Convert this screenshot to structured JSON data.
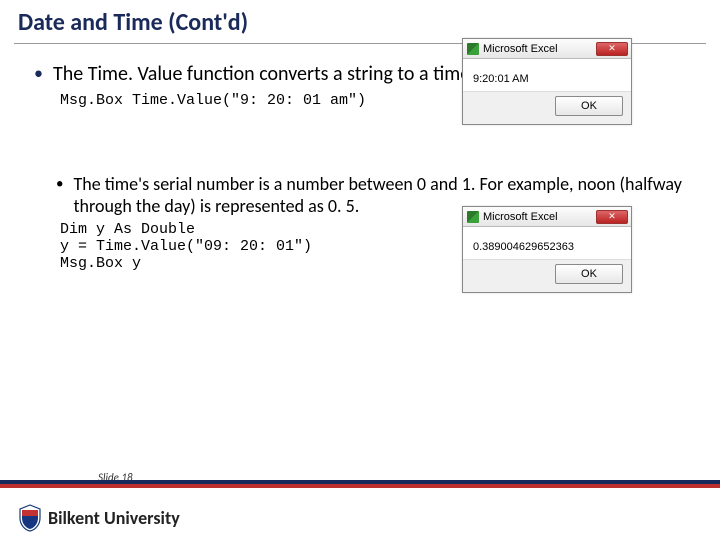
{
  "title": "Date and Time (Cont'd)",
  "bullet1": "The Time. Value function converts a string to a time serial number.",
  "code1": "Msg.Box Time.Value(\"9: 20: 01 am\")",
  "dialog1": {
    "title": "Microsoft Excel",
    "body": "9:20:01 AM",
    "ok": "OK"
  },
  "bullet2": "The time's serial number is a number between 0 and 1. For example, noon (halfway through the day) is represented as 0. 5.",
  "code2_l1": "Dim y As Double",
  "code2_l2": "y = Time.Value(\"09: 20: 01\")",
  "code2_l3": "Msg.Box y",
  "dialog2": {
    "title": "Microsoft Excel",
    "body": "0.389004629652363",
    "ok": "OK"
  },
  "slide_label": "Slide 18",
  "university": "Bilkent University"
}
